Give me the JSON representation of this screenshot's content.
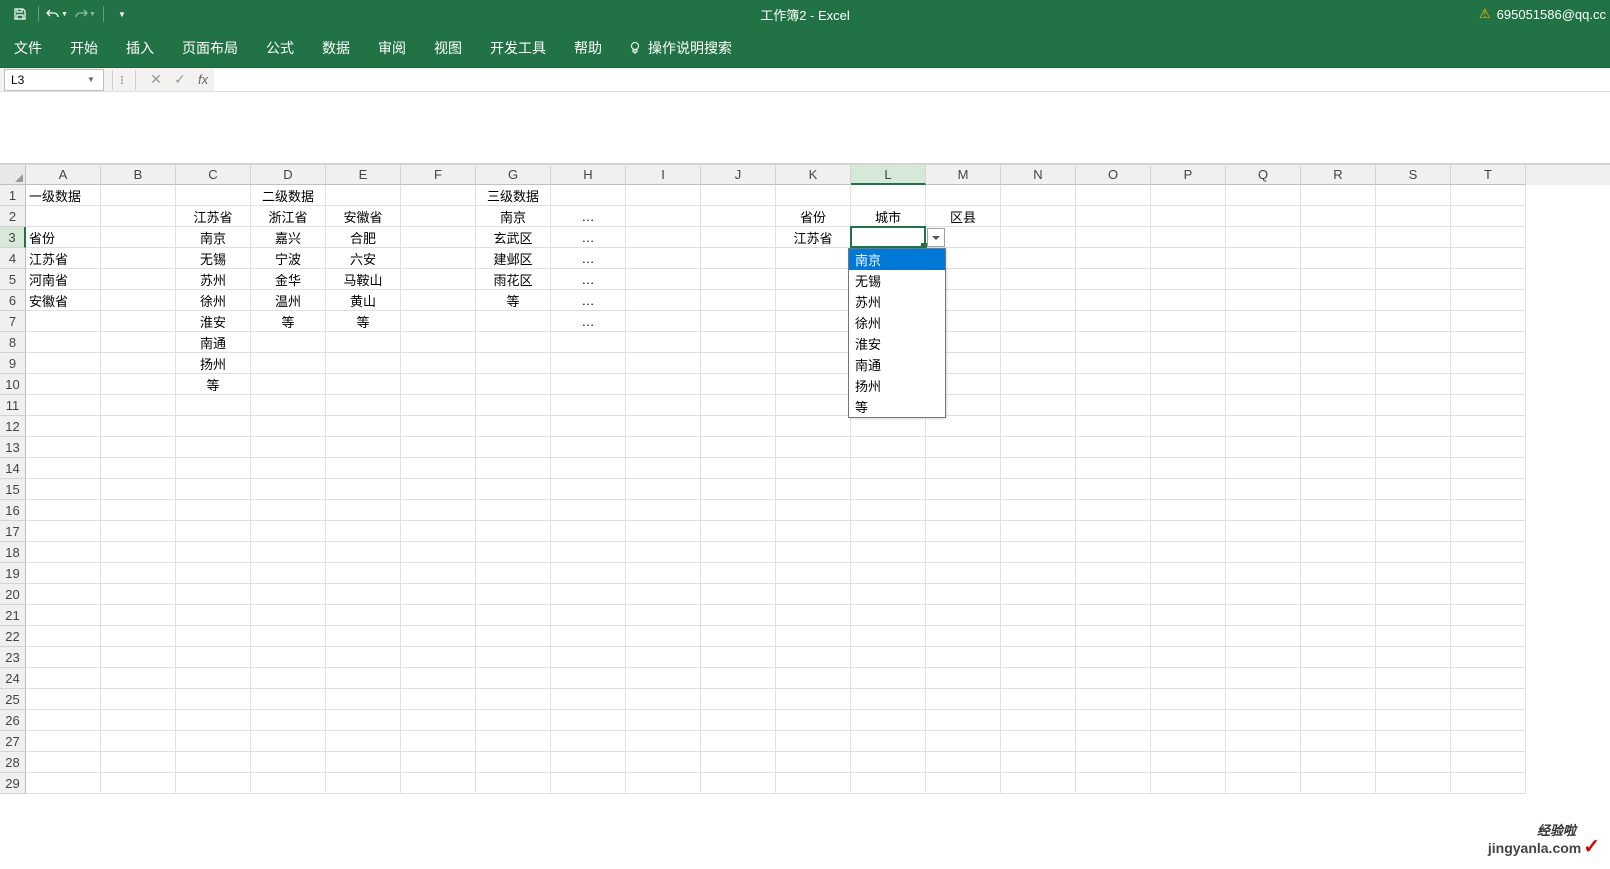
{
  "title": "工作簿2  -  Excel",
  "user": "695051586@qq.cc",
  "tabs": [
    "文件",
    "开始",
    "插入",
    "页面布局",
    "公式",
    "数据",
    "审阅",
    "视图",
    "开发工具",
    "帮助"
  ],
  "tell_me": "操作说明搜索",
  "name_box": "L3",
  "columns": [
    "A",
    "B",
    "C",
    "D",
    "E",
    "F",
    "G",
    "H",
    "I",
    "J",
    "K",
    "L",
    "M",
    "N",
    "O",
    "P",
    "Q",
    "R",
    "S",
    "T"
  ],
  "selected_col_idx": 11,
  "selected_row_idx": 2,
  "rows": [
    {
      "n": "1",
      "cells": {
        "A": "一级数据",
        "D": "二级数据",
        "G": "三级数据"
      }
    },
    {
      "n": "2",
      "cells": {
        "C": "江苏省",
        "D": "浙江省",
        "E": "安徽省",
        "G": "南京",
        "H": "…",
        "K": "省份",
        "L": "城市",
        "M": "区县"
      }
    },
    {
      "n": "3",
      "cells": {
        "A": "省份",
        "C": "南京",
        "D": "嘉兴",
        "E": "合肥",
        "G": "玄武区",
        "H": "…",
        "K": "江苏省"
      }
    },
    {
      "n": "4",
      "cells": {
        "A": "江苏省",
        "C": "无锡",
        "D": "宁波",
        "E": "六安",
        "G": "建邺区",
        "H": "…"
      }
    },
    {
      "n": "5",
      "cells": {
        "A": "河南省",
        "C": "苏州",
        "D": "金华",
        "E": "马鞍山",
        "G": "雨花区",
        "H": "…"
      }
    },
    {
      "n": "6",
      "cells": {
        "A": "安徽省",
        "C": "徐州",
        "D": "温州",
        "E": "黄山",
        "G": "等",
        "H": "…"
      }
    },
    {
      "n": "7",
      "cells": {
        "C": "淮安",
        "D": "等",
        "E": "等",
        "H": "…"
      }
    },
    {
      "n": "8",
      "cells": {
        "C": "南通"
      }
    },
    {
      "n": "9",
      "cells": {
        "C": "扬州"
      }
    },
    {
      "n": "10",
      "cells": {
        "C": "等"
      }
    },
    {
      "n": "11",
      "cells": {}
    },
    {
      "n": "12",
      "cells": {}
    },
    {
      "n": "13",
      "cells": {}
    },
    {
      "n": "14",
      "cells": {}
    },
    {
      "n": "15",
      "cells": {}
    },
    {
      "n": "16",
      "cells": {}
    },
    {
      "n": "17",
      "cells": {}
    },
    {
      "n": "18",
      "cells": {}
    },
    {
      "n": "19",
      "cells": {}
    },
    {
      "n": "20",
      "cells": {}
    },
    {
      "n": "21",
      "cells": {}
    },
    {
      "n": "22",
      "cells": {}
    },
    {
      "n": "23",
      "cells": {}
    },
    {
      "n": "24",
      "cells": {}
    },
    {
      "n": "25",
      "cells": {}
    },
    {
      "n": "26",
      "cells": {}
    },
    {
      "n": "27",
      "cells": {}
    },
    {
      "n": "28",
      "cells": {}
    },
    {
      "n": "29",
      "cells": {}
    }
  ],
  "centered_cols": [
    "C",
    "D",
    "E",
    "G",
    "H",
    "K",
    "L",
    "M"
  ],
  "header_centered": {
    "D": true,
    "G": true
  },
  "dropdown": {
    "items": [
      "南京",
      "无锡",
      "苏州",
      "徐州",
      "淮安",
      "南通",
      "扬州",
      "等"
    ],
    "highlighted": 0
  },
  "watermark": {
    "top": "经验啦",
    "main": "jingyanla.com"
  }
}
